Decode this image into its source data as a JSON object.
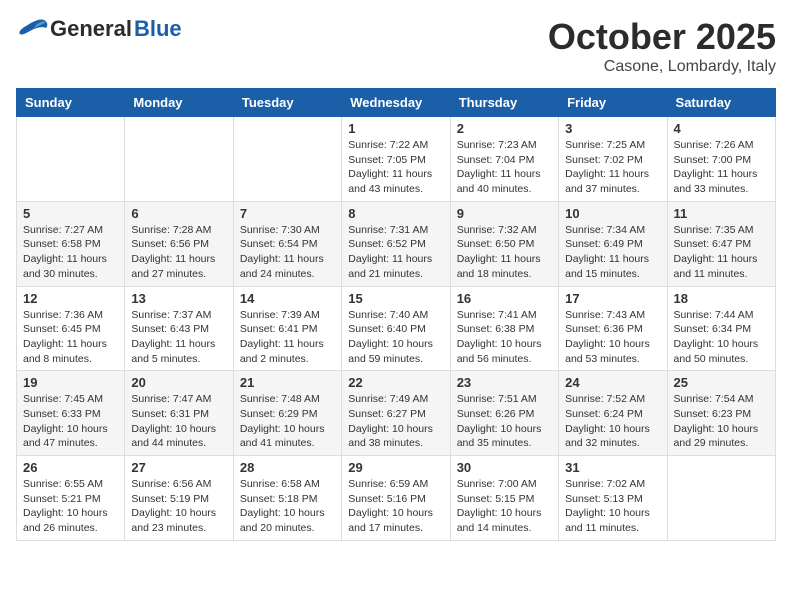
{
  "header": {
    "logo_general": "General",
    "logo_blue": "Blue",
    "month": "October 2025",
    "location": "Casone, Lombardy, Italy"
  },
  "weekdays": [
    "Sunday",
    "Monday",
    "Tuesday",
    "Wednesday",
    "Thursday",
    "Friday",
    "Saturday"
  ],
  "weeks": [
    [
      {
        "day": "",
        "sunrise": "",
        "sunset": "",
        "daylight": ""
      },
      {
        "day": "",
        "sunrise": "",
        "sunset": "",
        "daylight": ""
      },
      {
        "day": "",
        "sunrise": "",
        "sunset": "",
        "daylight": ""
      },
      {
        "day": "1",
        "sunrise": "Sunrise: 7:22 AM",
        "sunset": "Sunset: 7:05 PM",
        "daylight": "Daylight: 11 hours and 43 minutes."
      },
      {
        "day": "2",
        "sunrise": "Sunrise: 7:23 AM",
        "sunset": "Sunset: 7:04 PM",
        "daylight": "Daylight: 11 hours and 40 minutes."
      },
      {
        "day": "3",
        "sunrise": "Sunrise: 7:25 AM",
        "sunset": "Sunset: 7:02 PM",
        "daylight": "Daylight: 11 hours and 37 minutes."
      },
      {
        "day": "4",
        "sunrise": "Sunrise: 7:26 AM",
        "sunset": "Sunset: 7:00 PM",
        "daylight": "Daylight: 11 hours and 33 minutes."
      }
    ],
    [
      {
        "day": "5",
        "sunrise": "Sunrise: 7:27 AM",
        "sunset": "Sunset: 6:58 PM",
        "daylight": "Daylight: 11 hours and 30 minutes."
      },
      {
        "day": "6",
        "sunrise": "Sunrise: 7:28 AM",
        "sunset": "Sunset: 6:56 PM",
        "daylight": "Daylight: 11 hours and 27 minutes."
      },
      {
        "day": "7",
        "sunrise": "Sunrise: 7:30 AM",
        "sunset": "Sunset: 6:54 PM",
        "daylight": "Daylight: 11 hours and 24 minutes."
      },
      {
        "day": "8",
        "sunrise": "Sunrise: 7:31 AM",
        "sunset": "Sunset: 6:52 PM",
        "daylight": "Daylight: 11 hours and 21 minutes."
      },
      {
        "day": "9",
        "sunrise": "Sunrise: 7:32 AM",
        "sunset": "Sunset: 6:50 PM",
        "daylight": "Daylight: 11 hours and 18 minutes."
      },
      {
        "day": "10",
        "sunrise": "Sunrise: 7:34 AM",
        "sunset": "Sunset: 6:49 PM",
        "daylight": "Daylight: 11 hours and 15 minutes."
      },
      {
        "day": "11",
        "sunrise": "Sunrise: 7:35 AM",
        "sunset": "Sunset: 6:47 PM",
        "daylight": "Daylight: 11 hours and 11 minutes."
      }
    ],
    [
      {
        "day": "12",
        "sunrise": "Sunrise: 7:36 AM",
        "sunset": "Sunset: 6:45 PM",
        "daylight": "Daylight: 11 hours and 8 minutes."
      },
      {
        "day": "13",
        "sunrise": "Sunrise: 7:37 AM",
        "sunset": "Sunset: 6:43 PM",
        "daylight": "Daylight: 11 hours and 5 minutes."
      },
      {
        "day": "14",
        "sunrise": "Sunrise: 7:39 AM",
        "sunset": "Sunset: 6:41 PM",
        "daylight": "Daylight: 11 hours and 2 minutes."
      },
      {
        "day": "15",
        "sunrise": "Sunrise: 7:40 AM",
        "sunset": "Sunset: 6:40 PM",
        "daylight": "Daylight: 10 hours and 59 minutes."
      },
      {
        "day": "16",
        "sunrise": "Sunrise: 7:41 AM",
        "sunset": "Sunset: 6:38 PM",
        "daylight": "Daylight: 10 hours and 56 minutes."
      },
      {
        "day": "17",
        "sunrise": "Sunrise: 7:43 AM",
        "sunset": "Sunset: 6:36 PM",
        "daylight": "Daylight: 10 hours and 53 minutes."
      },
      {
        "day": "18",
        "sunrise": "Sunrise: 7:44 AM",
        "sunset": "Sunset: 6:34 PM",
        "daylight": "Daylight: 10 hours and 50 minutes."
      }
    ],
    [
      {
        "day": "19",
        "sunrise": "Sunrise: 7:45 AM",
        "sunset": "Sunset: 6:33 PM",
        "daylight": "Daylight: 10 hours and 47 minutes."
      },
      {
        "day": "20",
        "sunrise": "Sunrise: 7:47 AM",
        "sunset": "Sunset: 6:31 PM",
        "daylight": "Daylight: 10 hours and 44 minutes."
      },
      {
        "day": "21",
        "sunrise": "Sunrise: 7:48 AM",
        "sunset": "Sunset: 6:29 PM",
        "daylight": "Daylight: 10 hours and 41 minutes."
      },
      {
        "day": "22",
        "sunrise": "Sunrise: 7:49 AM",
        "sunset": "Sunset: 6:27 PM",
        "daylight": "Daylight: 10 hours and 38 minutes."
      },
      {
        "day": "23",
        "sunrise": "Sunrise: 7:51 AM",
        "sunset": "Sunset: 6:26 PM",
        "daylight": "Daylight: 10 hours and 35 minutes."
      },
      {
        "day": "24",
        "sunrise": "Sunrise: 7:52 AM",
        "sunset": "Sunset: 6:24 PM",
        "daylight": "Daylight: 10 hours and 32 minutes."
      },
      {
        "day": "25",
        "sunrise": "Sunrise: 7:54 AM",
        "sunset": "Sunset: 6:23 PM",
        "daylight": "Daylight: 10 hours and 29 minutes."
      }
    ],
    [
      {
        "day": "26",
        "sunrise": "Sunrise: 6:55 AM",
        "sunset": "Sunset: 5:21 PM",
        "daylight": "Daylight: 10 hours and 26 minutes."
      },
      {
        "day": "27",
        "sunrise": "Sunrise: 6:56 AM",
        "sunset": "Sunset: 5:19 PM",
        "daylight": "Daylight: 10 hours and 23 minutes."
      },
      {
        "day": "28",
        "sunrise": "Sunrise: 6:58 AM",
        "sunset": "Sunset: 5:18 PM",
        "daylight": "Daylight: 10 hours and 20 minutes."
      },
      {
        "day": "29",
        "sunrise": "Sunrise: 6:59 AM",
        "sunset": "Sunset: 5:16 PM",
        "daylight": "Daylight: 10 hours and 17 minutes."
      },
      {
        "day": "30",
        "sunrise": "Sunrise: 7:00 AM",
        "sunset": "Sunset: 5:15 PM",
        "daylight": "Daylight: 10 hours and 14 minutes."
      },
      {
        "day": "31",
        "sunrise": "Sunrise: 7:02 AM",
        "sunset": "Sunset: 5:13 PM",
        "daylight": "Daylight: 10 hours and 11 minutes."
      },
      {
        "day": "",
        "sunrise": "",
        "sunset": "",
        "daylight": ""
      }
    ]
  ]
}
